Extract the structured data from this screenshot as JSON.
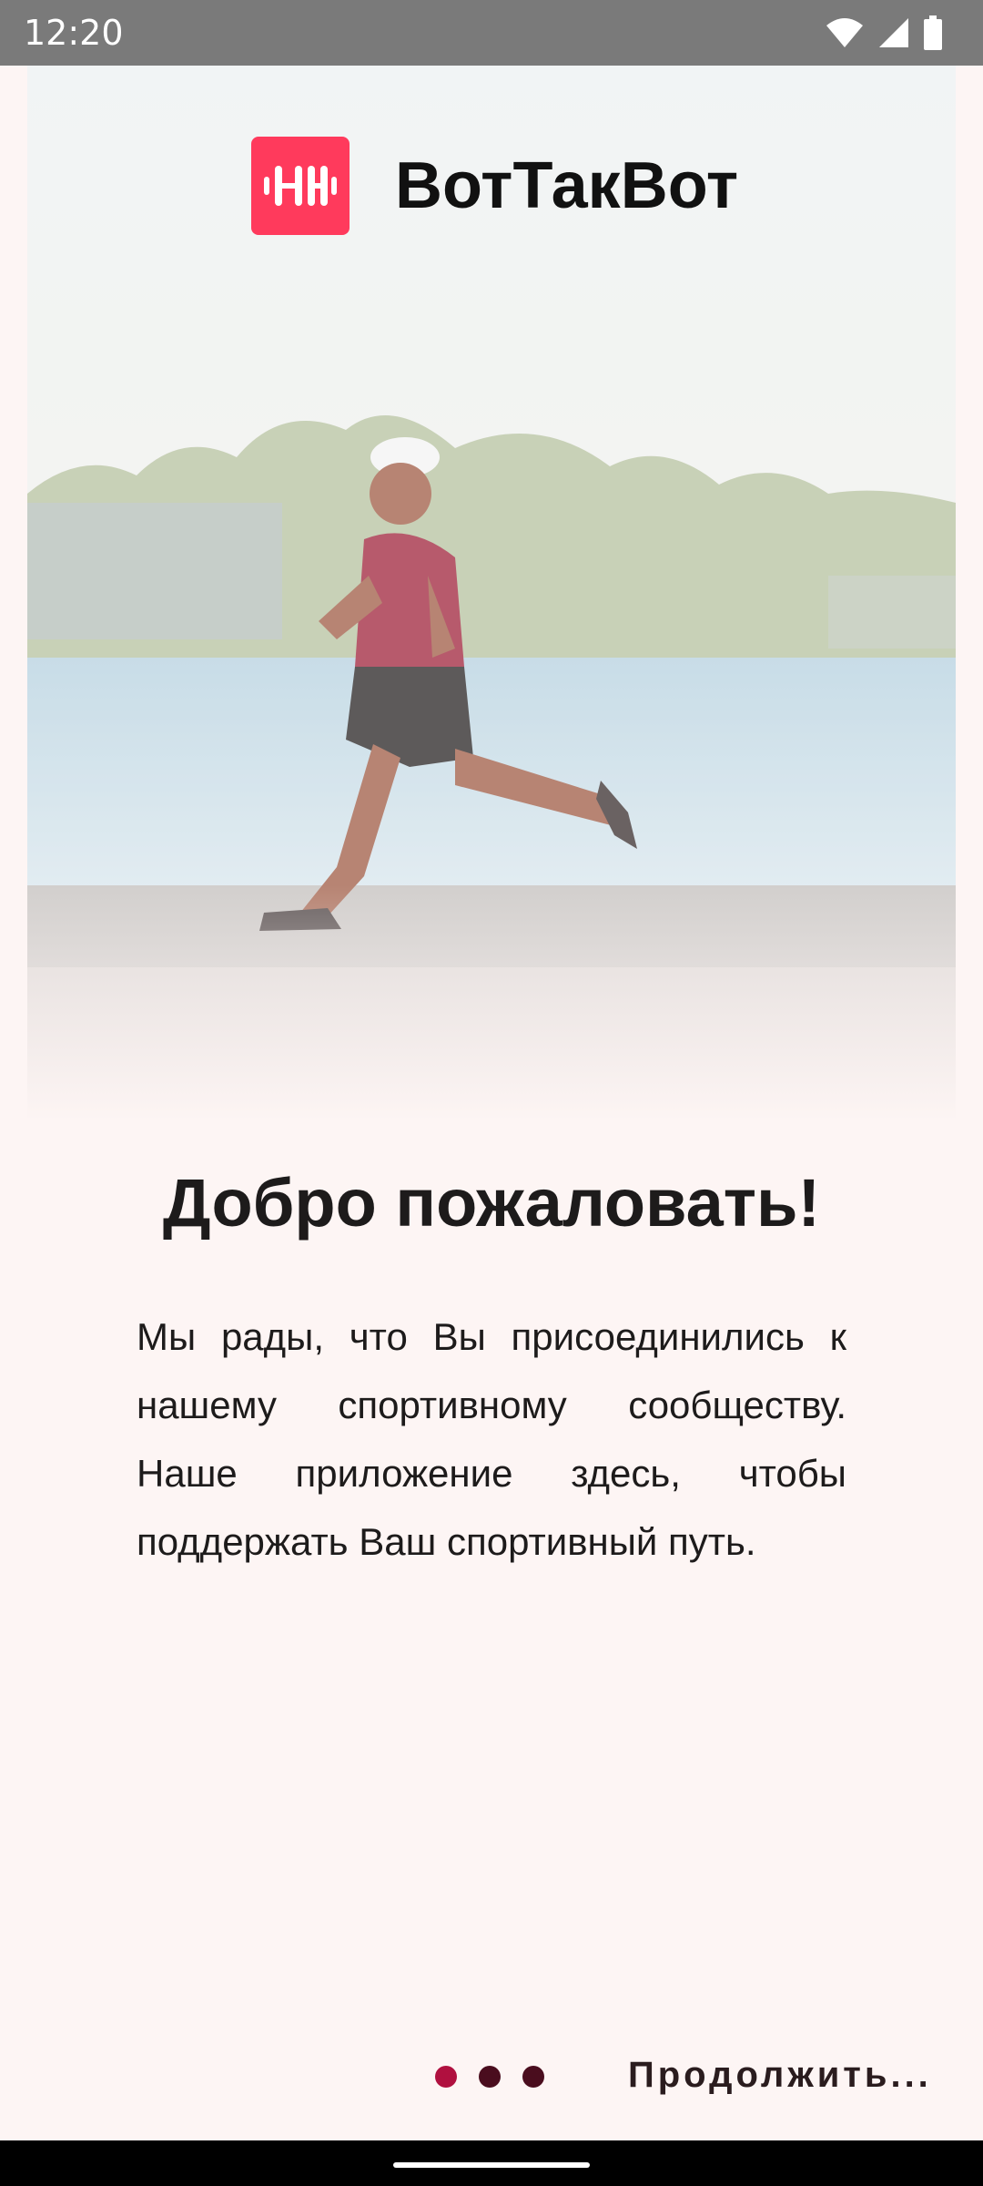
{
  "status_bar": {
    "time": "12:20",
    "icons": [
      "wifi-icon",
      "signal-icon",
      "battery-icon"
    ]
  },
  "hero": {
    "image": "runner-by-waterfront-photo"
  },
  "brand": {
    "logo_icon": "dumbbell-icon",
    "logo_color": "#ff3a5c",
    "name": "ВотТакВот"
  },
  "welcome": {
    "title": "Добро пожаловать!",
    "body": "Мы рады, что Вы присоединились к нашему спортивному сообществу. Наше приложение здесь, чтобы поддержать Ваш спортивный путь."
  },
  "pager": {
    "total": 3,
    "active": 1,
    "active_color": "#b0103f",
    "inactive_color": "#4a0d1e"
  },
  "actions": {
    "continue_label": "Продолжить..."
  }
}
